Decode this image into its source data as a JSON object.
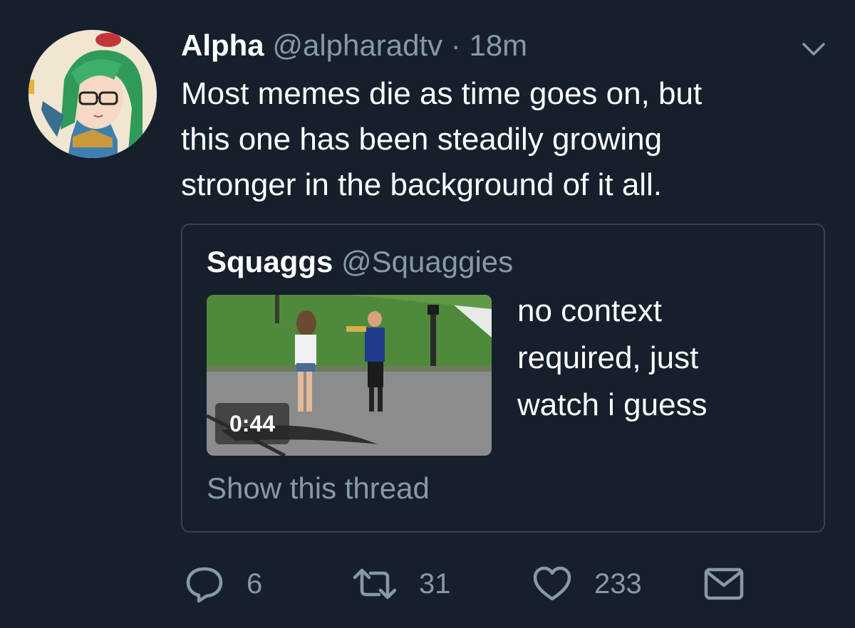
{
  "tweet": {
    "author_name": "Alpha",
    "author_handle": "@alpharadtv",
    "separator": "·",
    "time": "18m",
    "text_lines": [
      "Most memes die as time goes on, but",
      "this one has been steadily growing",
      "stronger in the background of it all."
    ],
    "menu_icon": "chevron-down-icon"
  },
  "quoted": {
    "author_name": "Squaggs",
    "author_handle": "@Squaggies",
    "video_duration": "0:44",
    "text_lines": [
      "no context",
      "required, just",
      "watch i guess"
    ],
    "show_thread": "Show this thread"
  },
  "actions": {
    "reply": {
      "icon": "reply-icon",
      "count": "6"
    },
    "retweet": {
      "icon": "retweet-icon",
      "count": "31"
    },
    "like": {
      "icon": "heart-icon",
      "count": "233"
    },
    "dm": {
      "icon": "envelope-icon"
    }
  },
  "colors": {
    "background": "#16202c",
    "secondary_text": "#8899a6",
    "border": "#38444d",
    "primary_text": "#ffffff"
  }
}
